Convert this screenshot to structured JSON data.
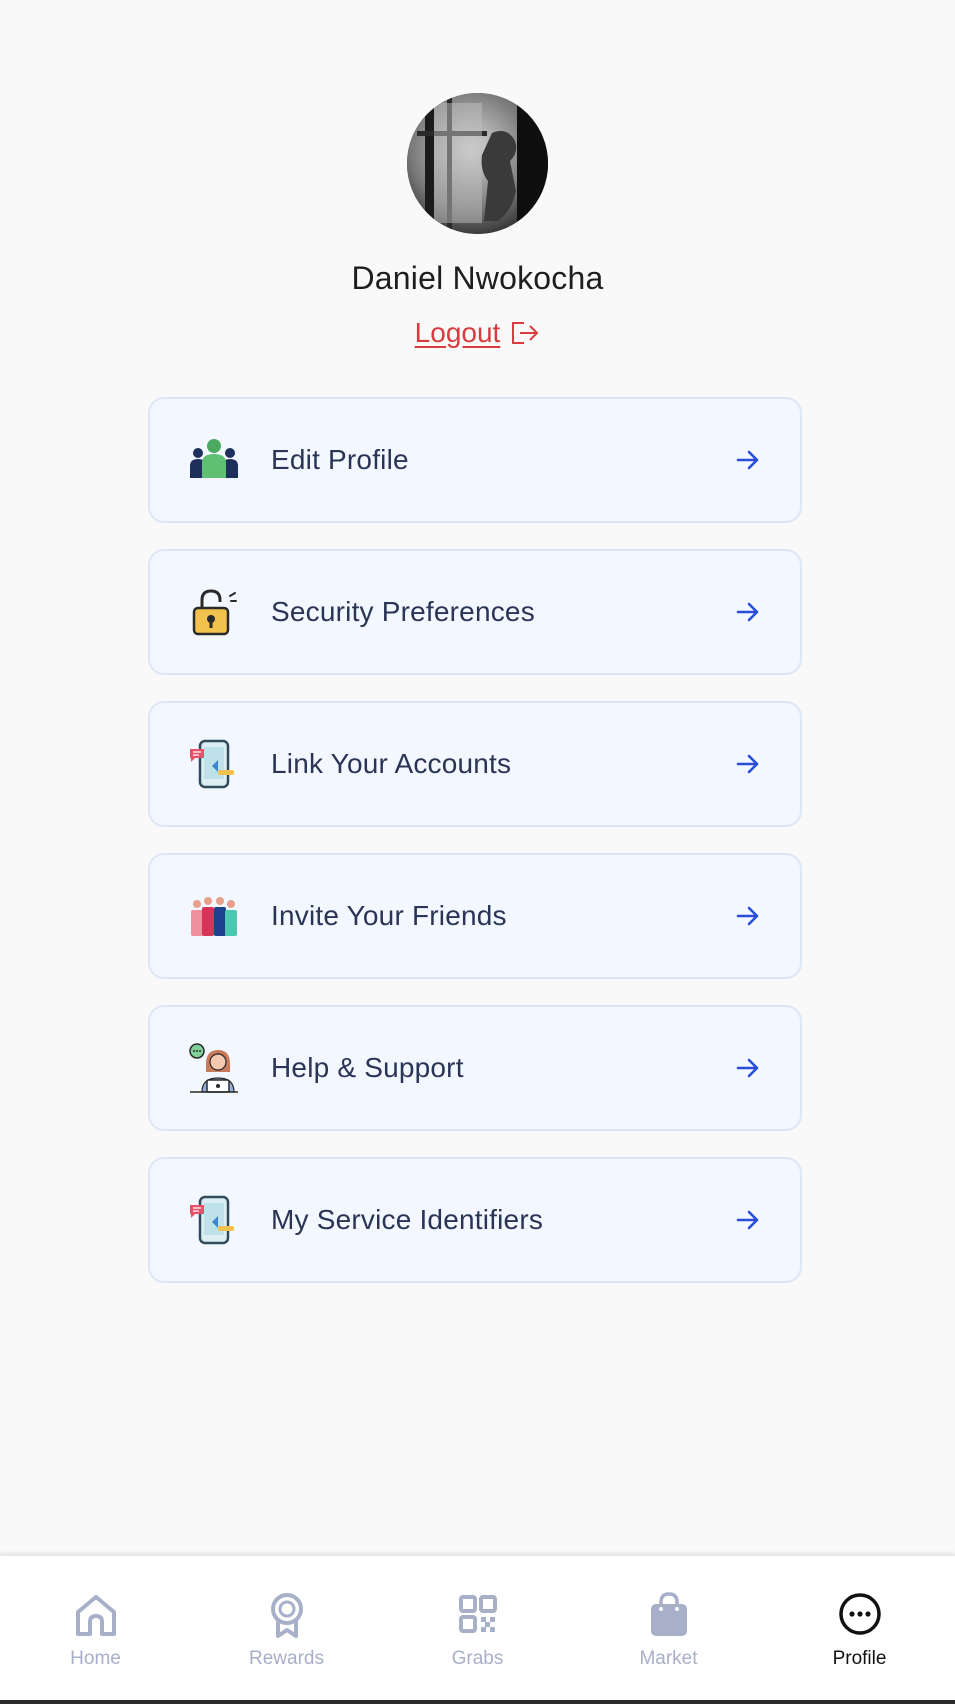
{
  "user": {
    "name": "Daniel Nwokocha",
    "logout_label": "Logout"
  },
  "menu": {
    "items": [
      {
        "label": "Edit Profile",
        "icon": "people-group-icon"
      },
      {
        "label": "Security Preferences",
        "icon": "unlocked-padlock-icon"
      },
      {
        "label": "Link Your Accounts",
        "icon": "phone-link-icon"
      },
      {
        "label": "Invite Your Friends",
        "icon": "friends-group-icon"
      },
      {
        "label": "Help & Support",
        "icon": "support-agent-icon"
      },
      {
        "label": "My Service Identifiers",
        "icon": "phone-link-icon"
      }
    ]
  },
  "nav": {
    "items": [
      {
        "label": "Home",
        "icon": "home-icon"
      },
      {
        "label": "Rewards",
        "icon": "award-ribbon-icon"
      },
      {
        "label": "Grabs",
        "icon": "qr-code-icon"
      },
      {
        "label": "Market",
        "icon": "shopping-bag-icon"
      },
      {
        "label": "Profile",
        "icon": "more-circle-icon"
      }
    ],
    "active": "Profile"
  },
  "colors": {
    "accent_blue": "#2a4fd6",
    "logout_red": "#d93b3f",
    "card_bg": "#f3f7ff",
    "nav_inactive": "#a8afc8"
  }
}
